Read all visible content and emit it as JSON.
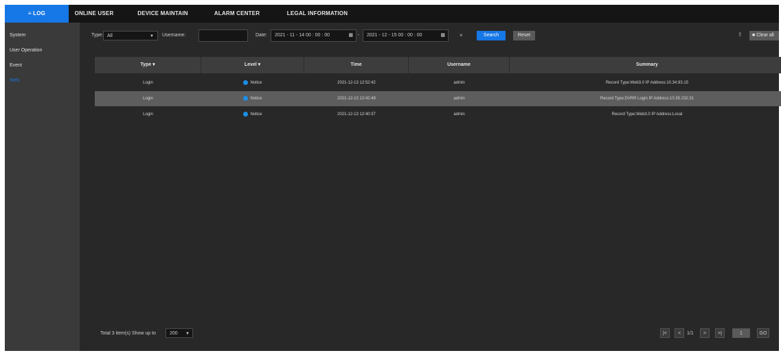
{
  "nav": {
    "tabs": [
      {
        "label": "≡ LOG"
      },
      {
        "label": "ONLINE USER"
      },
      {
        "label": "DEVICE MAINTAIN"
      },
      {
        "label": "ALARM CENTER"
      },
      {
        "label": "LEGAL INFORMATION"
      }
    ]
  },
  "sidebar": {
    "items": [
      {
        "label": "System"
      },
      {
        "label": "User Operation"
      },
      {
        "label": "Event"
      },
      {
        "label": "Web"
      }
    ]
  },
  "filters": {
    "type_label": "Type:",
    "type_value": "All",
    "username_label": "Username:",
    "username_value": "",
    "date_label": "Date:",
    "date_start": "2021 - 11 - 14  00 : 00 : 00",
    "date_sep": "-",
    "date_end": "2021 - 12 - 15  00 : 00 : 00",
    "search_label": "Search",
    "reset_label": "Reset",
    "clear_label": "Clear all"
  },
  "table": {
    "columns": [
      "Type",
      "Level",
      "Time",
      "Username",
      "Summary"
    ],
    "rows": [
      {
        "type": "Login",
        "level": "Notice",
        "time": "2021-12-13 12:52:42",
        "username": "admin",
        "summary": "Record Type:Web3.0 IP Address:10.34.93.15"
      },
      {
        "type": "Login",
        "level": "Notice",
        "time": "2021-12-13 12:42:49",
        "username": "admin",
        "summary": "Record Type:DVRR Login IP Address:10.35.232.31"
      },
      {
        "type": "Login",
        "level": "Notice",
        "time": "2021-12-13 12:40:37",
        "username": "admin",
        "summary": "Record Type:Web3.0 IP Address:Local"
      }
    ]
  },
  "footer": {
    "total_text": "Total  3  item(s)  Show up to",
    "page_size": "200",
    "first": "|<",
    "prev": "<",
    "page_info": "1/1",
    "next": ">",
    "last": ">|",
    "goto_value": "1",
    "go_label": "GO"
  },
  "colors": {
    "accent": "#1677e6",
    "notice_dot": "#1a8fe8"
  }
}
